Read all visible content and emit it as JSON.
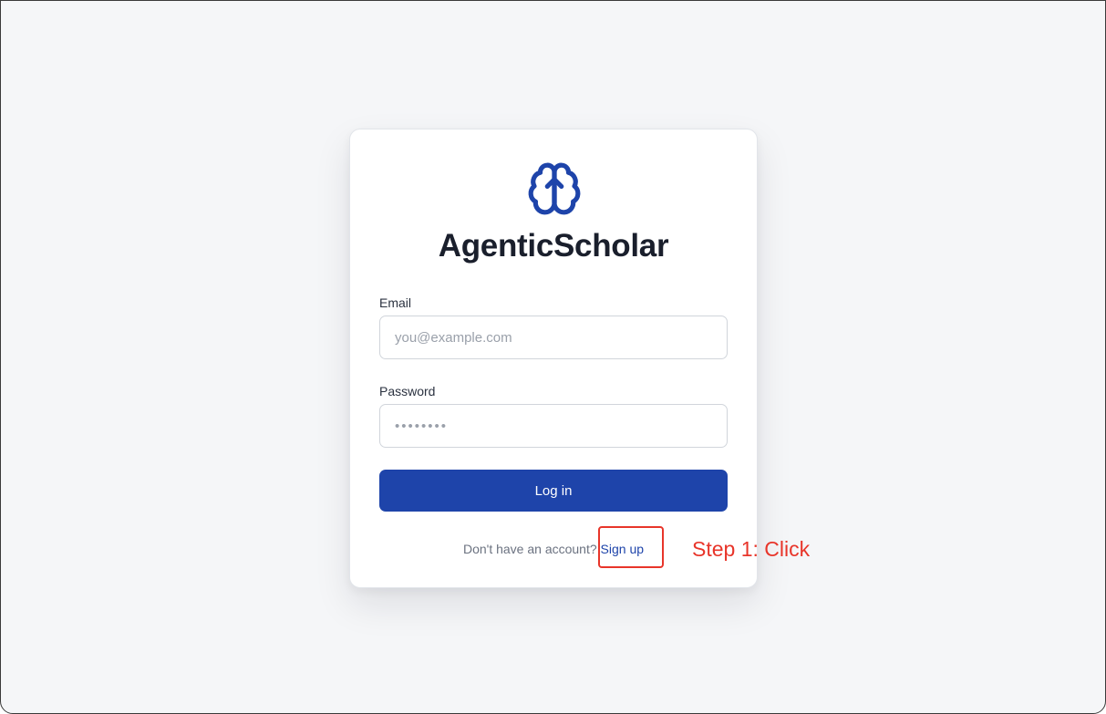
{
  "app": {
    "name": "AgenticScholar",
    "logo_icon": "brain-icon",
    "accent_color": "#1e44aa"
  },
  "login_form": {
    "email": {
      "label": "Email",
      "placeholder": "you@example.com",
      "value": ""
    },
    "password": {
      "label": "Password",
      "placeholder": "••••••••",
      "value": ""
    },
    "submit_label": "Log in",
    "signup_prompt": "Don't have an account?",
    "signup_link": "Sign up"
  },
  "annotation": {
    "text": "Step 1: Click",
    "color": "#e8352a"
  }
}
